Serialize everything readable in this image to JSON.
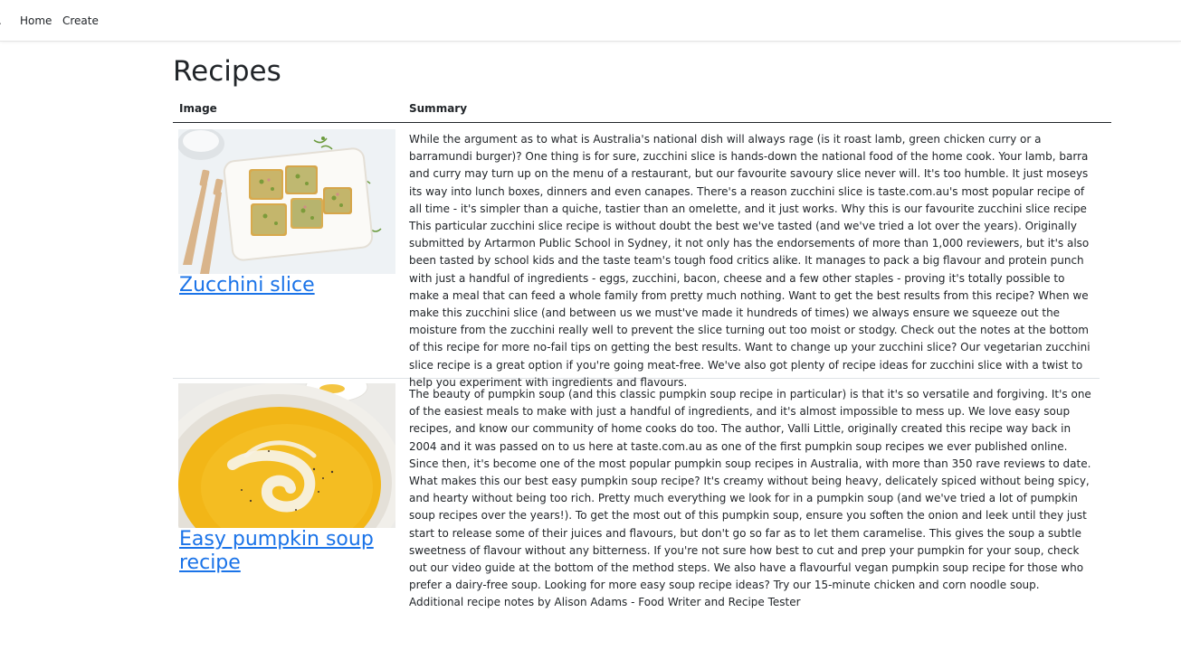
{
  "nav": {
    "brand": ".",
    "home": "Home",
    "create": "Create"
  },
  "page": {
    "title": "Recipes"
  },
  "table": {
    "headers": [
      "Image",
      "Summary"
    ],
    "rows": [
      {
        "title": "Zucchini slice",
        "summary": "While the argument as to what is Australia's national dish will always rage (is it roast lamb, green chicken curry or a barramundi burger)? One thing is for sure, zucchini slice is hands-down the national food of the home cook. Your lamb, barra and curry may turn up on the menu of a restaurant, but our favourite savoury slice never will. It's too humble. It just moseys its way into lunch boxes, dinners and even canapes. There's a reason zucchini slice is taste.com.au's most popular recipe of all time - it's simpler than a quiche, tastier than an omelette, and it just works. Why this is our favourite zucchini slice recipe This particular zucchini slice recipe is without doubt the best we've tasted (and we've tried a lot over the years). Originally submitted by Artarmon Public School in Sydney, it not only has the endorsements of more than 1,000 reviewers, but it's also been tasted by school kids and the taste team's tough food critics alike. It manages to pack a big flavour and protein punch with just a handful of ingredients - eggs, zucchini, bacon, cheese and a few other staples - proving it's totally possible to make a meal that can feed a whole family from pretty much nothing. Want to get the best results from this recipe? When we make this zucchini slice (and between us we must've made it hundreds of times) we always ensure we squeeze out the moisture from the zucchini really well to prevent the slice turning out too moist or stodgy. Check out the notes at the bottom of this recipe for more no-fail tips on getting the best results. Want to change up your zucchini slice? Our vegetarian zucchini slice recipe is a great option if you're going meat-free. We've also got plenty of recipe ideas for zucchini slice with a twist to help you experiment with ingredients and flavours."
      },
      {
        "title": "Easy pumpkin soup recipe",
        "summary": "The beauty of pumpkin soup (and this classic pumpkin soup recipe in particular) is that it's so versatile and forgiving. It's one of the easiest meals to make with just a handful of ingredients, and it's almost impossible to mess up. We love easy soup recipes, and know our community of home cooks do too. The author, Valli Little, originally created this recipe way back in 2004 and it was passed on to us here at taste.com.au as one of the first pumpkin soup recipes we ever published online. Since then, it's become one of the most popular pumpkin soup recipes in Australia, with more than 350 rave reviews to date. What makes this our best easy pumpkin soup recipe? It's creamy without being heavy, delicately spiced without being spicy, and hearty without being too rich. Pretty much everything we look for in a pumpkin soup (and we've tried a lot of pumpkin soup recipes over the years!). To get the most out of this pumpkin soup, ensure you soften the onion and leek until they just start to release some of their juices and flavours, but don't go so far as to let them caramelise. This gives the soup a subtle sweetness of flavour without any bitterness. If you're not sure how best to cut and prep your pumpkin for your soup, check out our video guide at the bottom of the method steps. We also have a flavourful vegan pumpkin soup recipe for those who prefer a dairy-free soup. Looking for more easy soup recipe ideas? Try our 15-minute chicken and corn noodle soup. Additional recipe notes by Alison Adams - Food Writer and Recipe Tester"
      }
    ]
  },
  "colors": {
    "link": "#1a73e8",
    "text": "#212529",
    "border": "#dee2e6"
  }
}
